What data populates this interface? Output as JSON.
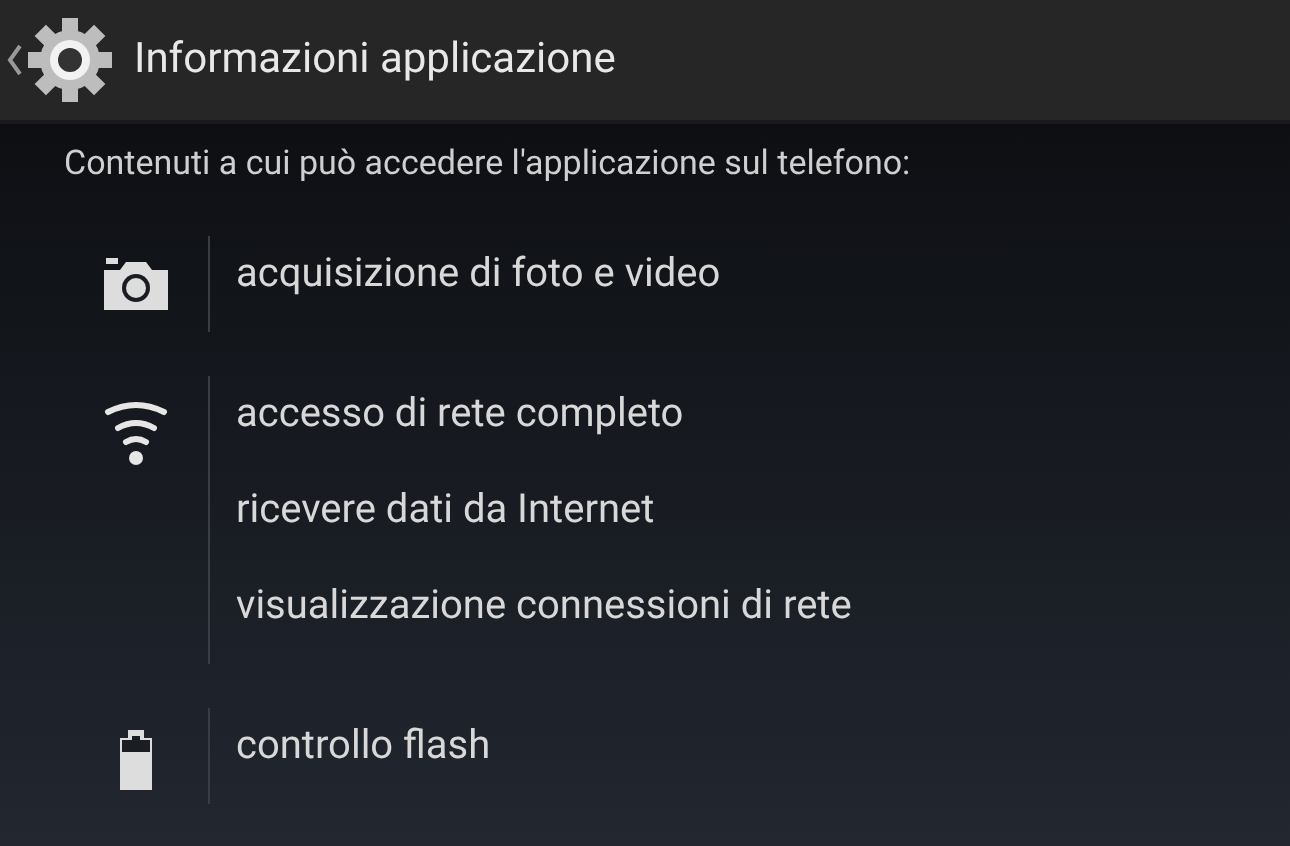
{
  "action_bar": {
    "title": "Informazioni applicazione"
  },
  "subtitle": "Contenuti a cui può accedere l'applicazione sul telefono:",
  "groups": [
    {
      "kind": "camera",
      "items": [
        "acquisizione di foto e video"
      ]
    },
    {
      "kind": "wifi",
      "items": [
        "accesso di rete completo",
        "ricevere dati da Internet",
        "visualizzazione connessioni di rete"
      ]
    },
    {
      "kind": "battery",
      "items": [
        "controllo flash"
      ]
    }
  ]
}
